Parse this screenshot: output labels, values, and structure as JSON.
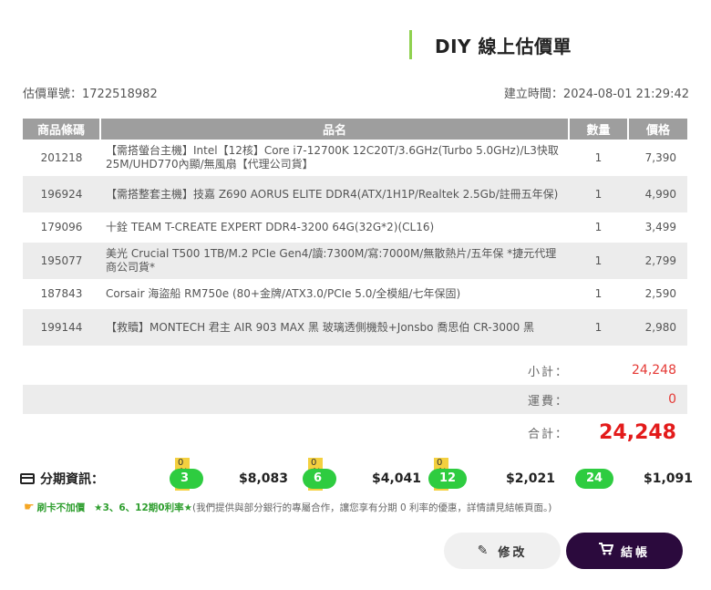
{
  "header": {
    "title": "DIY 線上估價單"
  },
  "meta": {
    "quote_label": "估價單號：1722518982",
    "created_label": "建立時間：2024-08-01 21:29:42"
  },
  "table": {
    "headers": [
      "商品條碼",
      "品名",
      "數量",
      "價格"
    ],
    "rows": [
      {
        "code": "201218",
        "name": "【需搭螢台主機】Intel【12核】Core i7-12700K 12C20T/3.6GHz(Turbo 5.0GHz)/L3快取25M/UHD770內顯/無風扇【代理公司貨】",
        "qty": "1",
        "price": "7,390"
      },
      {
        "code": "196924",
        "name": "【需搭整套主機】技嘉 Z690 AORUS ELITE DDR4(ATX/1H1P/Realtek 2.5Gb/註冊五年保)",
        "qty": "1",
        "price": "4,990"
      },
      {
        "code": "179096",
        "name": "十銓 TEAM T-CREATE EXPERT DDR4-3200 64G(32G*2)(CL16)",
        "qty": "1",
        "price": "3,499"
      },
      {
        "code": "195077",
        "name": "美光 Crucial T500 1TB/M.2 PCIe Gen4/讀:7300M/寫:7000M/無散熱片/五年保 *捷元代理商公司貨*",
        "qty": "1",
        "price": "2,799"
      },
      {
        "code": "187843",
        "name": "Corsair 海盜船 RM750e (80+金牌/ATX3.0/PCIe 5.0/全模組/七年保固)",
        "qty": "1",
        "price": "2,590"
      },
      {
        "code": "199144",
        "name": "【救贖】MONTECH 君主 AIR 903 MAX 黑 玻璃透側機殼+Jonsbo 喬思伯 CR-3000 黑",
        "qty": "1",
        "price": "2,980"
      }
    ]
  },
  "totals": {
    "subtotal_label": "小計：",
    "subtotal": "24,248",
    "shipping_label": "運費：",
    "shipping": "0",
    "total_label": "合計：",
    "total": "24,248"
  },
  "installments": {
    "label": "分期資訊：",
    "zero_tag": "0利率",
    "plans": [
      {
        "period": "3期",
        "amount": "$8,083",
        "zero": true
      },
      {
        "period": "6期",
        "amount": "$4,041",
        "zero": true
      },
      {
        "period": "12期",
        "amount": "$2,021",
        "zero": true
      },
      {
        "period": "24期",
        "amount": "$1,091",
        "zero": false
      }
    ]
  },
  "note": {
    "tag": "刷卡不加價",
    "highlight": "★3、6、12期0利率★",
    "text": "(我們提供與部分銀行的專屬合作，讓您享有分期 0 利率的優惠，詳情請見結帳頁面。)"
  },
  "buttons": {
    "edit": "修改",
    "checkout": "結帳"
  },
  "colors": {
    "accent_green": "#2ecc40",
    "total_red": "#e31b1b",
    "checkout_bg": "#2b0a3d",
    "title_bar": "#8fd14f"
  }
}
